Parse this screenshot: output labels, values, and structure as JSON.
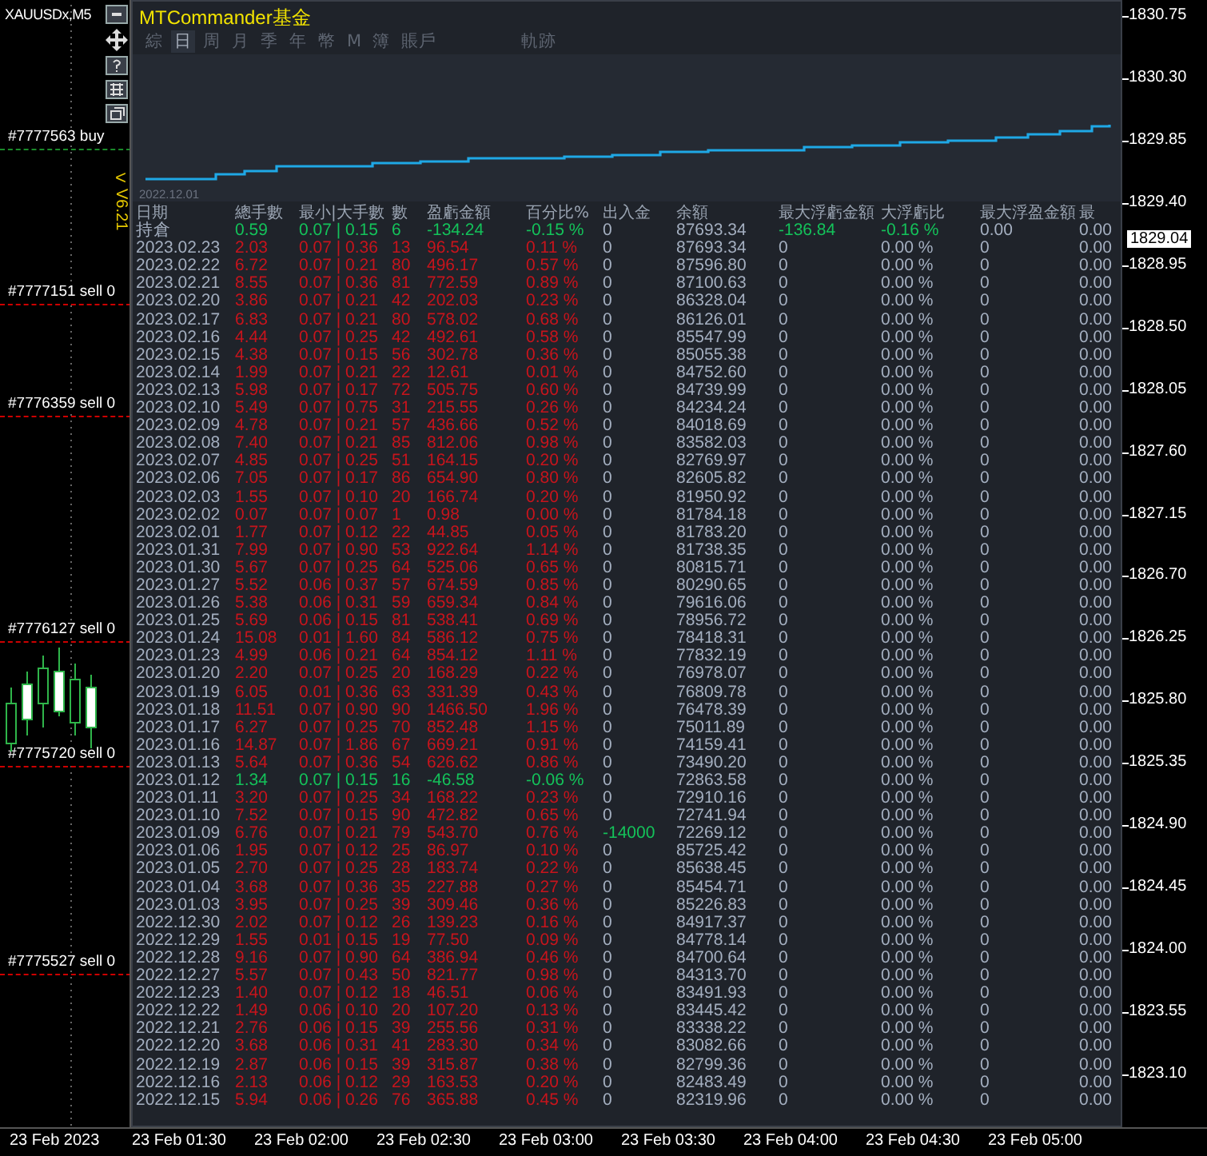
{
  "chart": {
    "symbol": "XAUUSDx,M5",
    "version": "V6.21",
    "collapse_arrow": "<",
    "order_labels": [
      {
        "text": "#7777563 buy",
        "kind": "buy"
      },
      {
        "text": "#7777151 sell 0",
        "kind": "sell"
      },
      {
        "text": "#7776359 sell 0",
        "kind": "sell"
      },
      {
        "text": "#7776127 sell 0",
        "kind": "sell"
      },
      {
        "text": "#7775720 sell 0",
        "kind": "sell"
      },
      {
        "text": "#7775527 sell 0",
        "kind": "sell"
      }
    ]
  },
  "panel": {
    "title": "MTCommander基金",
    "tabs": [
      {
        "label": "綜",
        "selected": false
      },
      {
        "label": "日",
        "selected": true
      },
      {
        "label": "周",
        "selected": false
      },
      {
        "label": "月",
        "selected": false
      },
      {
        "label": "季",
        "selected": false
      },
      {
        "label": "年",
        "selected": false
      },
      {
        "label": "幣",
        "selected": false
      },
      {
        "label": "M",
        "selected": false
      },
      {
        "label": "簿",
        "selected": false
      },
      {
        "label": "賬戶",
        "selected": false
      },
      {
        "label": "軌跡",
        "selected": false
      }
    ],
    "equity_chart": {
      "start_date": "2022.12.01"
    },
    "table": {
      "columns": [
        "日期",
        "總手數",
        "最小|大手數",
        "數",
        "盈虧金額",
        "百分比%",
        "出入金",
        "余額",
        "最大浮虧金額",
        "大浮虧比",
        "最大浮盈金額",
        "最"
      ],
      "rows": [
        {
          "kind": "open",
          "date": "持倉",
          "lots": "0.59",
          "min_max": "0.07 | 0.15",
          "trades": "6",
          "pnl": "-134.24",
          "pct": "-0.15 %",
          "flow": "0",
          "flow_highlight": false,
          "balance": "87693.34",
          "max_float_loss": "-136.84",
          "max_float_loss_pct": "-0.16 %",
          "max_float_profit": "0.00",
          "column_12": "0.00"
        },
        {
          "kind": "gain",
          "date": "2023.02.23",
          "lots": "2.03",
          "min_max": "0.07 | 0.36",
          "trades": "13",
          "pnl": "96.54",
          "pct": "0.11 %",
          "flow": "0",
          "flow_highlight": false,
          "balance": "87693.34",
          "max_float_loss": "0",
          "max_float_loss_pct": "0.00 %",
          "max_float_profit": "0",
          "column_12": "0.00"
        },
        {
          "kind": "gain",
          "date": "2023.02.22",
          "lots": "6.72",
          "min_max": "0.07 | 0.21",
          "trades": "80",
          "pnl": "496.17",
          "pct": "0.57 %",
          "flow": "0",
          "flow_highlight": false,
          "balance": "87596.80",
          "max_float_loss": "0",
          "max_float_loss_pct": "0.00 %",
          "max_float_profit": "0",
          "column_12": "0.00"
        },
        {
          "kind": "gain",
          "date": "2023.02.21",
          "lots": "8.55",
          "min_max": "0.07 | 0.36",
          "trades": "81",
          "pnl": "772.59",
          "pct": "0.89 %",
          "flow": "0",
          "flow_highlight": false,
          "balance": "87100.63",
          "max_float_loss": "0",
          "max_float_loss_pct": "0.00 %",
          "max_float_profit": "0",
          "column_12": "0.00"
        },
        {
          "kind": "gain",
          "date": "2023.02.20",
          "lots": "3.86",
          "min_max": "0.07 | 0.21",
          "trades": "42",
          "pnl": "202.03",
          "pct": "0.23 %",
          "flow": "0",
          "flow_highlight": false,
          "balance": "86328.04",
          "max_float_loss": "0",
          "max_float_loss_pct": "0.00 %",
          "max_float_profit": "0",
          "column_12": "0.00"
        },
        {
          "kind": "gain",
          "date": "2023.02.17",
          "lots": "6.83",
          "min_max": "0.07 | 0.21",
          "trades": "80",
          "pnl": "578.02",
          "pct": "0.68 %",
          "flow": "0",
          "flow_highlight": false,
          "balance": "86126.01",
          "max_float_loss": "0",
          "max_float_loss_pct": "0.00 %",
          "max_float_profit": "0",
          "column_12": "0.00"
        },
        {
          "kind": "gain",
          "date": "2023.02.16",
          "lots": "4.44",
          "min_max": "0.07 | 0.25",
          "trades": "42",
          "pnl": "492.61",
          "pct": "0.58 %",
          "flow": "0",
          "flow_highlight": false,
          "balance": "85547.99",
          "max_float_loss": "0",
          "max_float_loss_pct": "0.00 %",
          "max_float_profit": "0",
          "column_12": "0.00"
        },
        {
          "kind": "gain",
          "date": "2023.02.15",
          "lots": "4.38",
          "min_max": "0.07 | 0.15",
          "trades": "56",
          "pnl": "302.78",
          "pct": "0.36 %",
          "flow": "0",
          "flow_highlight": false,
          "balance": "85055.38",
          "max_float_loss": "0",
          "max_float_loss_pct": "0.00 %",
          "max_float_profit": "0",
          "column_12": "0.00"
        },
        {
          "kind": "gain",
          "date": "2023.02.14",
          "lots": "1.99",
          "min_max": "0.07 | 0.21",
          "trades": "22",
          "pnl": "12.61",
          "pct": "0.01 %",
          "flow": "0",
          "flow_highlight": false,
          "balance": "84752.60",
          "max_float_loss": "0",
          "max_float_loss_pct": "0.00 %",
          "max_float_profit": "0",
          "column_12": "0.00"
        },
        {
          "kind": "gain",
          "date": "2023.02.13",
          "lots": "5.98",
          "min_max": "0.07 | 0.17",
          "trades": "72",
          "pnl": "505.75",
          "pct": "0.60 %",
          "flow": "0",
          "flow_highlight": false,
          "balance": "84739.99",
          "max_float_loss": "0",
          "max_float_loss_pct": "0.00 %",
          "max_float_profit": "0",
          "column_12": "0.00"
        },
        {
          "kind": "gain",
          "date": "2023.02.10",
          "lots": "5.49",
          "min_max": "0.07 | 0.75",
          "trades": "31",
          "pnl": "215.55",
          "pct": "0.26 %",
          "flow": "0",
          "flow_highlight": false,
          "balance": "84234.24",
          "max_float_loss": "0",
          "max_float_loss_pct": "0.00 %",
          "max_float_profit": "0",
          "column_12": "0.00"
        },
        {
          "kind": "gain",
          "date": "2023.02.09",
          "lots": "4.78",
          "min_max": "0.07 | 0.21",
          "trades": "57",
          "pnl": "436.66",
          "pct": "0.52 %",
          "flow": "0",
          "flow_highlight": false,
          "balance": "84018.69",
          "max_float_loss": "0",
          "max_float_loss_pct": "0.00 %",
          "max_float_profit": "0",
          "column_12": "0.00"
        },
        {
          "kind": "gain",
          "date": "2023.02.08",
          "lots": "7.40",
          "min_max": "0.07 | 0.21",
          "trades": "85",
          "pnl": "812.06",
          "pct": "0.98 %",
          "flow": "0",
          "flow_highlight": false,
          "balance": "83582.03",
          "max_float_loss": "0",
          "max_float_loss_pct": "0.00 %",
          "max_float_profit": "0",
          "column_12": "0.00"
        },
        {
          "kind": "gain",
          "date": "2023.02.07",
          "lots": "4.85",
          "min_max": "0.07 | 0.25",
          "trades": "51",
          "pnl": "164.15",
          "pct": "0.20 %",
          "flow": "0",
          "flow_highlight": false,
          "balance": "82769.97",
          "max_float_loss": "0",
          "max_float_loss_pct": "0.00 %",
          "max_float_profit": "0",
          "column_12": "0.00"
        },
        {
          "kind": "gain",
          "date": "2023.02.06",
          "lots": "7.05",
          "min_max": "0.07 | 0.17",
          "trades": "86",
          "pnl": "654.90",
          "pct": "0.80 %",
          "flow": "0",
          "flow_highlight": false,
          "balance": "82605.82",
          "max_float_loss": "0",
          "max_float_loss_pct": "0.00 %",
          "max_float_profit": "0",
          "column_12": "0.00"
        },
        {
          "kind": "gain",
          "date": "2023.02.03",
          "lots": "1.55",
          "min_max": "0.07 | 0.10",
          "trades": "20",
          "pnl": "166.74",
          "pct": "0.20 %",
          "flow": "0",
          "flow_highlight": false,
          "balance": "81950.92",
          "max_float_loss": "0",
          "max_float_loss_pct": "0.00 %",
          "max_float_profit": "0",
          "column_12": "0.00"
        },
        {
          "kind": "gain",
          "date": "2023.02.02",
          "lots": "0.07",
          "min_max": "0.07 | 0.07",
          "trades": "1",
          "pnl": "0.98",
          "pct": "0.00 %",
          "flow": "0",
          "flow_highlight": false,
          "balance": "81784.18",
          "max_float_loss": "0",
          "max_float_loss_pct": "0.00 %",
          "max_float_profit": "0",
          "column_12": "0.00"
        },
        {
          "kind": "gain",
          "date": "2023.02.01",
          "lots": "1.77",
          "min_max": "0.07 | 0.12",
          "trades": "22",
          "pnl": "44.85",
          "pct": "0.05 %",
          "flow": "0",
          "flow_highlight": false,
          "balance": "81783.20",
          "max_float_loss": "0",
          "max_float_loss_pct": "0.00 %",
          "max_float_profit": "0",
          "column_12": "0.00"
        },
        {
          "kind": "gain",
          "date": "2023.01.31",
          "lots": "7.99",
          "min_max": "0.07 | 0.90",
          "trades": "53",
          "pnl": "922.64",
          "pct": "1.14 %",
          "flow": "0",
          "flow_highlight": false,
          "balance": "81738.35",
          "max_float_loss": "0",
          "max_float_loss_pct": "0.00 %",
          "max_float_profit": "0",
          "column_12": "0.00"
        },
        {
          "kind": "gain",
          "date": "2023.01.30",
          "lots": "5.67",
          "min_max": "0.07 | 0.25",
          "trades": "64",
          "pnl": "525.06",
          "pct": "0.65 %",
          "flow": "0",
          "flow_highlight": false,
          "balance": "80815.71",
          "max_float_loss": "0",
          "max_float_loss_pct": "0.00 %",
          "max_float_profit": "0",
          "column_12": "0.00"
        },
        {
          "kind": "gain",
          "date": "2023.01.27",
          "lots": "5.52",
          "min_max": "0.06 | 0.37",
          "trades": "57",
          "pnl": "674.59",
          "pct": "0.85 %",
          "flow": "0",
          "flow_highlight": false,
          "balance": "80290.65",
          "max_float_loss": "0",
          "max_float_loss_pct": "0.00 %",
          "max_float_profit": "0",
          "column_12": "0.00"
        },
        {
          "kind": "gain",
          "date": "2023.01.26",
          "lots": "5.38",
          "min_max": "0.06 | 0.31",
          "trades": "59",
          "pnl": "659.34",
          "pct": "0.84 %",
          "flow": "0",
          "flow_highlight": false,
          "balance": "79616.06",
          "max_float_loss": "0",
          "max_float_loss_pct": "0.00 %",
          "max_float_profit": "0",
          "column_12": "0.00"
        },
        {
          "kind": "gain",
          "date": "2023.01.25",
          "lots": "5.69",
          "min_max": "0.06 | 0.15",
          "trades": "81",
          "pnl": "538.41",
          "pct": "0.69 %",
          "flow": "0",
          "flow_highlight": false,
          "balance": "78956.72",
          "max_float_loss": "0",
          "max_float_loss_pct": "0.00 %",
          "max_float_profit": "0",
          "column_12": "0.00"
        },
        {
          "kind": "gain",
          "date": "2023.01.24",
          "lots": "15.08",
          "min_max": "0.01 | 1.60",
          "trades": "84",
          "pnl": "586.12",
          "pct": "0.75 %",
          "flow": "0",
          "flow_highlight": false,
          "balance": "78418.31",
          "max_float_loss": "0",
          "max_float_loss_pct": "0.00 %",
          "max_float_profit": "0",
          "column_12": "0.00"
        },
        {
          "kind": "gain",
          "date": "2023.01.23",
          "lots": "4.99",
          "min_max": "0.06 | 0.21",
          "trades": "64",
          "pnl": "854.12",
          "pct": "1.11 %",
          "flow": "0",
          "flow_highlight": false,
          "balance": "77832.19",
          "max_float_loss": "0",
          "max_float_loss_pct": "0.00 %",
          "max_float_profit": "0",
          "column_12": "0.00"
        },
        {
          "kind": "gain",
          "date": "2023.01.20",
          "lots": "2.20",
          "min_max": "0.07 | 0.25",
          "trades": "20",
          "pnl": "168.29",
          "pct": "0.22 %",
          "flow": "0",
          "flow_highlight": false,
          "balance": "76978.07",
          "max_float_loss": "0",
          "max_float_loss_pct": "0.00 %",
          "max_float_profit": "0",
          "column_12": "0.00"
        },
        {
          "kind": "gain",
          "date": "2023.01.19",
          "lots": "6.05",
          "min_max": "0.01 | 0.36",
          "trades": "63",
          "pnl": "331.39",
          "pct": "0.43 %",
          "flow": "0",
          "flow_highlight": false,
          "balance": "76809.78",
          "max_float_loss": "0",
          "max_float_loss_pct": "0.00 %",
          "max_float_profit": "0",
          "column_12": "0.00"
        },
        {
          "kind": "gain",
          "date": "2023.01.18",
          "lots": "11.51",
          "min_max": "0.07 | 0.90",
          "trades": "90",
          "pnl": "1466.50",
          "pct": "1.96 %",
          "flow": "0",
          "flow_highlight": false,
          "balance": "76478.39",
          "max_float_loss": "0",
          "max_float_loss_pct": "0.00 %",
          "max_float_profit": "0",
          "column_12": "0.00"
        },
        {
          "kind": "gain",
          "date": "2023.01.17",
          "lots": "6.27",
          "min_max": "0.07 | 0.25",
          "trades": "70",
          "pnl": "852.48",
          "pct": "1.15 %",
          "flow": "0",
          "flow_highlight": false,
          "balance": "75011.89",
          "max_float_loss": "0",
          "max_float_loss_pct": "0.00 %",
          "max_float_profit": "0",
          "column_12": "0.00"
        },
        {
          "kind": "gain",
          "date": "2023.01.16",
          "lots": "14.87",
          "min_max": "0.07 | 1.86",
          "trades": "67",
          "pnl": "669.21",
          "pct": "0.91 %",
          "flow": "0",
          "flow_highlight": false,
          "balance": "74159.41",
          "max_float_loss": "0",
          "max_float_loss_pct": "0.00 %",
          "max_float_profit": "0",
          "column_12": "0.00"
        },
        {
          "kind": "gain",
          "date": "2023.01.13",
          "lots": "5.64",
          "min_max": "0.07 | 0.36",
          "trades": "54",
          "pnl": "626.62",
          "pct": "0.86 %",
          "flow": "0",
          "flow_highlight": false,
          "balance": "73490.20",
          "max_float_loss": "0",
          "max_float_loss_pct": "0.00 %",
          "max_float_profit": "0",
          "column_12": "0.00"
        },
        {
          "kind": "loss",
          "date": "2023.01.12",
          "lots": "1.34",
          "min_max": "0.07 | 0.15",
          "trades": "16",
          "pnl": "-46.58",
          "pct": "-0.06 %",
          "flow": "0",
          "flow_highlight": false,
          "balance": "72863.58",
          "max_float_loss": "0",
          "max_float_loss_pct": "0.00 %",
          "max_float_profit": "0",
          "column_12": "0.00"
        },
        {
          "kind": "gain",
          "date": "2023.01.11",
          "lots": "3.20",
          "min_max": "0.07 | 0.25",
          "trades": "34",
          "pnl": "168.22",
          "pct": "0.23 %",
          "flow": "0",
          "flow_highlight": false,
          "balance": "72910.16",
          "max_float_loss": "0",
          "max_float_loss_pct": "0.00 %",
          "max_float_profit": "0",
          "column_12": "0.00"
        },
        {
          "kind": "gain",
          "date": "2023.01.10",
          "lots": "7.52",
          "min_max": "0.07 | 0.15",
          "trades": "90",
          "pnl": "472.82",
          "pct": "0.65 %",
          "flow": "0",
          "flow_highlight": false,
          "balance": "72741.94",
          "max_float_loss": "0",
          "max_float_loss_pct": "0.00 %",
          "max_float_profit": "0",
          "column_12": "0.00"
        },
        {
          "kind": "gain",
          "date": "2023.01.09",
          "lots": "6.76",
          "min_max": "0.07 | 0.21",
          "trades": "79",
          "pnl": "543.70",
          "pct": "0.76 %",
          "flow": "-14000",
          "flow_highlight": true,
          "balance": "72269.12",
          "max_float_loss": "0",
          "max_float_loss_pct": "0.00 %",
          "max_float_profit": "0",
          "column_12": "0.00"
        },
        {
          "kind": "gain",
          "date": "2023.01.06",
          "lots": "1.95",
          "min_max": "0.07 | 0.12",
          "trades": "25",
          "pnl": "86.97",
          "pct": "0.10 %",
          "flow": "0",
          "flow_highlight": false,
          "balance": "85725.42",
          "max_float_loss": "0",
          "max_float_loss_pct": "0.00 %",
          "max_float_profit": "0",
          "column_12": "0.00"
        },
        {
          "kind": "gain",
          "date": "2023.01.05",
          "lots": "2.70",
          "min_max": "0.07 | 0.25",
          "trades": "28",
          "pnl": "183.74",
          "pct": "0.22 %",
          "flow": "0",
          "flow_highlight": false,
          "balance": "85638.45",
          "max_float_loss": "0",
          "max_float_loss_pct": "0.00 %",
          "max_float_profit": "0",
          "column_12": "0.00"
        },
        {
          "kind": "gain",
          "date": "2023.01.04",
          "lots": "3.68",
          "min_max": "0.07 | 0.36",
          "trades": "35",
          "pnl": "227.88",
          "pct": "0.27 %",
          "flow": "0",
          "flow_highlight": false,
          "balance": "85454.71",
          "max_float_loss": "0",
          "max_float_loss_pct": "0.00 %",
          "max_float_profit": "0",
          "column_12": "0.00"
        },
        {
          "kind": "gain",
          "date": "2023.01.03",
          "lots": "3.95",
          "min_max": "0.07 | 0.25",
          "trades": "39",
          "pnl": "309.46",
          "pct": "0.36 %",
          "flow": "0",
          "flow_highlight": false,
          "balance": "85226.83",
          "max_float_loss": "0",
          "max_float_loss_pct": "0.00 %",
          "max_float_profit": "0",
          "column_12": "0.00"
        },
        {
          "kind": "gain",
          "date": "2022.12.30",
          "lots": "2.02",
          "min_max": "0.07 | 0.12",
          "trades": "26",
          "pnl": "139.23",
          "pct": "0.16 %",
          "flow": "0",
          "flow_highlight": false,
          "balance": "84917.37",
          "max_float_loss": "0",
          "max_float_loss_pct": "0.00 %",
          "max_float_profit": "0",
          "column_12": "0.00"
        },
        {
          "kind": "gain",
          "date": "2022.12.29",
          "lots": "1.55",
          "min_max": "0.01 | 0.15",
          "trades": "19",
          "pnl": "77.50",
          "pct": "0.09 %",
          "flow": "0",
          "flow_highlight": false,
          "balance": "84778.14",
          "max_float_loss": "0",
          "max_float_loss_pct": "0.00 %",
          "max_float_profit": "0",
          "column_12": "0.00"
        },
        {
          "kind": "gain",
          "date": "2022.12.28",
          "lots": "9.16",
          "min_max": "0.07 | 0.90",
          "trades": "64",
          "pnl": "386.94",
          "pct": "0.46 %",
          "flow": "0",
          "flow_highlight": false,
          "balance": "84700.64",
          "max_float_loss": "0",
          "max_float_loss_pct": "0.00 %",
          "max_float_profit": "0",
          "column_12": "0.00"
        },
        {
          "kind": "gain",
          "date": "2022.12.27",
          "lots": "5.57",
          "min_max": "0.07 | 0.43",
          "trades": "50",
          "pnl": "821.77",
          "pct": "0.98 %",
          "flow": "0",
          "flow_highlight": false,
          "balance": "84313.70",
          "max_float_loss": "0",
          "max_float_loss_pct": "0.00 %",
          "max_float_profit": "0",
          "column_12": "0.00"
        },
        {
          "kind": "gain",
          "date": "2022.12.23",
          "lots": "1.40",
          "min_max": "0.07 | 0.12",
          "trades": "18",
          "pnl": "46.51",
          "pct": "0.06 %",
          "flow": "0",
          "flow_highlight": false,
          "balance": "83491.93",
          "max_float_loss": "0",
          "max_float_loss_pct": "0.00 %",
          "max_float_profit": "0",
          "column_12": "0.00"
        },
        {
          "kind": "gain",
          "date": "2022.12.22",
          "lots": "1.49",
          "min_max": "0.06 | 0.10",
          "trades": "20",
          "pnl": "107.20",
          "pct": "0.13 %",
          "flow": "0",
          "flow_highlight": false,
          "balance": "83445.42",
          "max_float_loss": "0",
          "max_float_loss_pct": "0.00 %",
          "max_float_profit": "0",
          "column_12": "0.00"
        },
        {
          "kind": "gain",
          "date": "2022.12.21",
          "lots": "2.76",
          "min_max": "0.06 | 0.15",
          "trades": "39",
          "pnl": "255.56",
          "pct": "0.31 %",
          "flow": "0",
          "flow_highlight": false,
          "balance": "83338.22",
          "max_float_loss": "0",
          "max_float_loss_pct": "0.00 %",
          "max_float_profit": "0",
          "column_12": "0.00"
        },
        {
          "kind": "gain",
          "date": "2022.12.20",
          "lots": "3.68",
          "min_max": "0.06 | 0.31",
          "trades": "41",
          "pnl": "283.30",
          "pct": "0.34 %",
          "flow": "0",
          "flow_highlight": false,
          "balance": "83082.66",
          "max_float_loss": "0",
          "max_float_loss_pct": "0.00 %",
          "max_float_profit": "0",
          "column_12": "0.00"
        },
        {
          "kind": "gain",
          "date": "2022.12.19",
          "lots": "2.87",
          "min_max": "0.06 | 0.15",
          "trades": "39",
          "pnl": "315.87",
          "pct": "0.38 %",
          "flow": "0",
          "flow_highlight": false,
          "balance": "82799.36",
          "max_float_loss": "0",
          "max_float_loss_pct": "0.00 %",
          "max_float_profit": "0",
          "column_12": "0.00"
        },
        {
          "kind": "gain",
          "date": "2022.12.16",
          "lots": "2.13",
          "min_max": "0.06 | 0.12",
          "trades": "29",
          "pnl": "163.53",
          "pct": "0.20 %",
          "flow": "0",
          "flow_highlight": false,
          "balance": "82483.49",
          "max_float_loss": "0",
          "max_float_loss_pct": "0.00 %",
          "max_float_profit": "0",
          "column_12": "0.00"
        },
        {
          "kind": "gain",
          "date": "2022.12.15",
          "lots": "5.94",
          "min_max": "0.06 | 0.26",
          "trades": "76",
          "pnl": "365.88",
          "pct": "0.45 %",
          "flow": "0",
          "flow_highlight": false,
          "balance": "82319.96",
          "max_float_loss": "0",
          "max_float_loss_pct": "0.00 %",
          "max_float_profit": "0",
          "column_12": "0.00"
        }
      ]
    }
  },
  "price_axis": {
    "labels": [
      "1830.75",
      "1830.30",
      "1829.85",
      "1829.40",
      "1828.95",
      "1828.50",
      "1828.05",
      "1827.60",
      "1827.15",
      "1826.70",
      "1826.25",
      "1825.80",
      "1825.35",
      "1824.90",
      "1824.45",
      "1824.00",
      "1823.55",
      "1823.10"
    ],
    "current_price": "1829.04"
  },
  "time_axis": [
    "23 Feb 2023",
    "23 Feb 01:30",
    "23 Feb 02:00",
    "23 Feb 02:30",
    "23 Feb 03:00",
    "23 Feb 03:30",
    "23 Feb 04:00",
    "23 Feb 04:30",
    "23 Feb 05:00"
  ]
}
